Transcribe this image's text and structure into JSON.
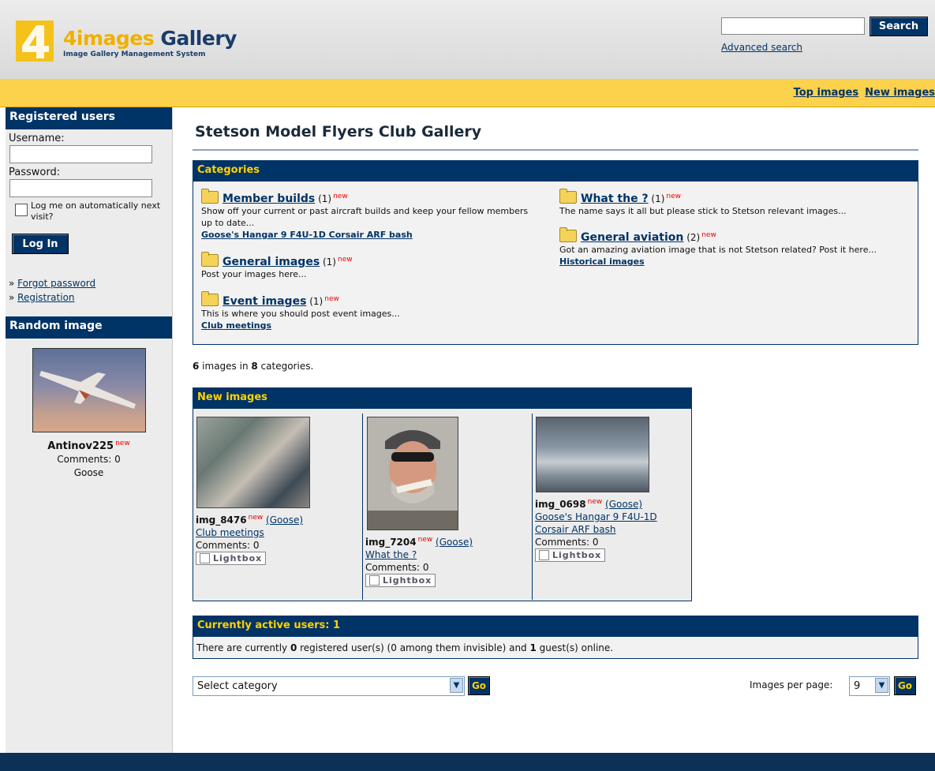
{
  "header": {
    "logo_title_a": "4images",
    "logo_title_b": "Gallery",
    "logo_subtitle": "Image Gallery Management System",
    "search_button": "Search",
    "advanced_search": "Advanced search"
  },
  "topnav": {
    "top_images": "Top images",
    "new_images": "New images"
  },
  "sidebar": {
    "registered_heading": "Registered users",
    "username_label": "Username:",
    "password_label": "Password:",
    "remember_label": "Log me on automatically next visit?",
    "login_button": "Log In",
    "forgot_password": "Forgot password",
    "registration": "Registration",
    "random_heading": "Random image",
    "random_name": "Antinov225",
    "random_new": "new",
    "random_comments": "Comments: 0",
    "random_user": "Goose"
  },
  "page_title": "Stetson Model Flyers Club Gallery",
  "categories": {
    "heading": "Categories",
    "left": [
      {
        "title": "Member builds",
        "count": "(1)",
        "new": "new",
        "desc": "Show off your current or past aircraft builds and keep your fellow members up to date...",
        "sub": "Goose's Hangar 9 F4U-1D Corsair ARF bash"
      },
      {
        "title": "General images",
        "count": "(1)",
        "new": "new",
        "desc": "Post your images here...",
        "sub": ""
      },
      {
        "title": "Event images",
        "count": "(1)",
        "new": "new",
        "desc": "This is where you should post event images...",
        "sub": "Club meetings"
      }
    ],
    "right": [
      {
        "title": "What the ?",
        "count": "(1)",
        "new": "new",
        "desc": "The name says it all but please stick to Stetson relevant images...",
        "sub": ""
      },
      {
        "title": "General aviation",
        "count": "(2)",
        "new": "new",
        "desc": "Got an amazing aviation image that is not Stetson related? Post it here...",
        "sub": "Historical images"
      }
    ]
  },
  "stats": {
    "images": "6",
    "images_in": " images in ",
    "categories": "8",
    "suffix": " categories."
  },
  "new_images": {
    "heading": "New images",
    "items": [
      {
        "name": "img_8476",
        "new": "new",
        "user": "(Goose)",
        "category": "Club meetings",
        "category2": "",
        "comments": "Comments: 0",
        "lightbox": "Lightbox"
      },
      {
        "name": "img_7204",
        "new": "new",
        "user": "(Goose)",
        "category": "What the ?",
        "category2": "",
        "comments": "Comments: 0",
        "lightbox": "Lightbox"
      },
      {
        "name": "img_0698",
        "new": "new",
        "user": "(Goose)",
        "category": "Goose's Hangar 9 F4U-1D",
        "category2": "Corsair ARF bash",
        "comments": "Comments: 0",
        "lightbox": "Lightbox"
      }
    ]
  },
  "active_users": {
    "heading": "Currently active users: 1",
    "t1": "There are currently ",
    "registered": "0",
    "t2": " registered user(s) (0 among them invisible) and ",
    "guests": "1",
    "t3": " guest(s) online."
  },
  "controls": {
    "select_category": "Select category",
    "go": "Go",
    "per_page_label": "Images per page:",
    "per_page_value": "9"
  }
}
